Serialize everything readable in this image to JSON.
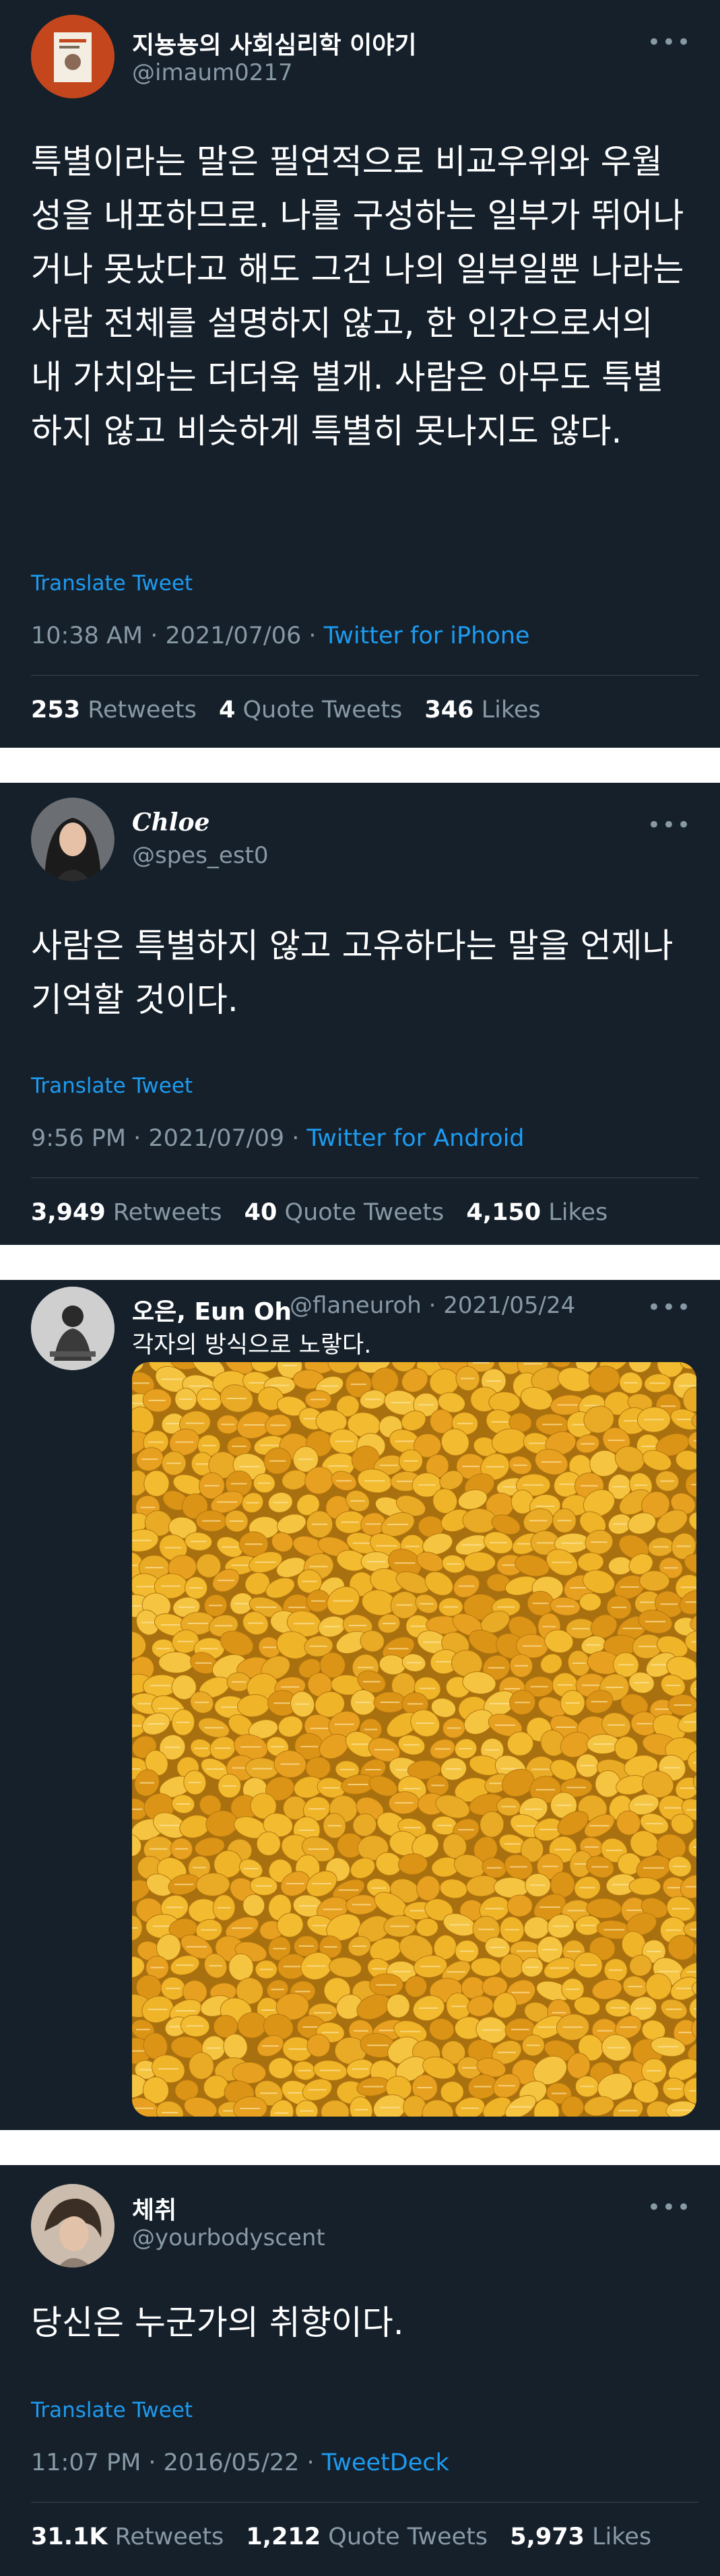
{
  "tweets": [
    {
      "name": "지뇽뇽의 사회심리학 이야기",
      "handle": "@imaum0217",
      "more": "•••",
      "text": "특별이라는 말은 필연적으로 비교우위와 우월성을 내포하므로. 나를 구성하는 일부가 뛰어나거나 못났다고 해도 그건 나의 일부일뿐 나라는 사람 전체를 설명하지 않고, 한 인간으로서의 내 가치와는 더더욱 별개. 사람은 아무도 특별하지 않고 비슷하게 특별히 못나지도 않다.",
      "translate": "Translate Tweet",
      "time": "10:38 AM · 2021/07/06 · ",
      "source": "Twitter for iPhone",
      "retweets": "253",
      "retweets_label": "Retweets",
      "quotes": "4",
      "quotes_label": "Quote Tweets",
      "likes": "346",
      "likes_label": "Likes"
    },
    {
      "name": "Chloe",
      "handle": "@spes_est0",
      "more": "•••",
      "text": "사람은 특별하지 않고 고유하다는 말을 언제나 기억할 것이다.",
      "translate": "Translate Tweet",
      "time": "9:56 PM · 2021/07/09 · ",
      "source": "Twitter for Android",
      "retweets": "3,949",
      "retweets_label": "Retweets",
      "quotes": "40",
      "quotes_label": "Quote Tweets",
      "likes": "4,150",
      "likes_label": "Likes"
    },
    {
      "name": "오은, Eun Oh",
      "handle": "@flaneuroh · 2021/05/24",
      "more": "•••",
      "text": "각자의 방식으로 노랗다."
    },
    {
      "name": "체취",
      "handle": "@yourbodyscent",
      "more": "•••",
      "text": "당신은 누군가의 취향이다.",
      "translate": "Translate Tweet",
      "time": "11:07 PM · 2016/05/22 · ",
      "source": "TweetDeck",
      "retweets": "31.1K",
      "retweets_label": "Retweets",
      "quotes": "1,212",
      "quotes_label": "Quote Tweets",
      "likes": "5,973",
      "likes_label": "Likes"
    }
  ],
  "colors": {
    "background": "#15202b",
    "accent": "#1d9bf0",
    "secondary_text": "#8899a6",
    "melon": "#e8a020"
  }
}
